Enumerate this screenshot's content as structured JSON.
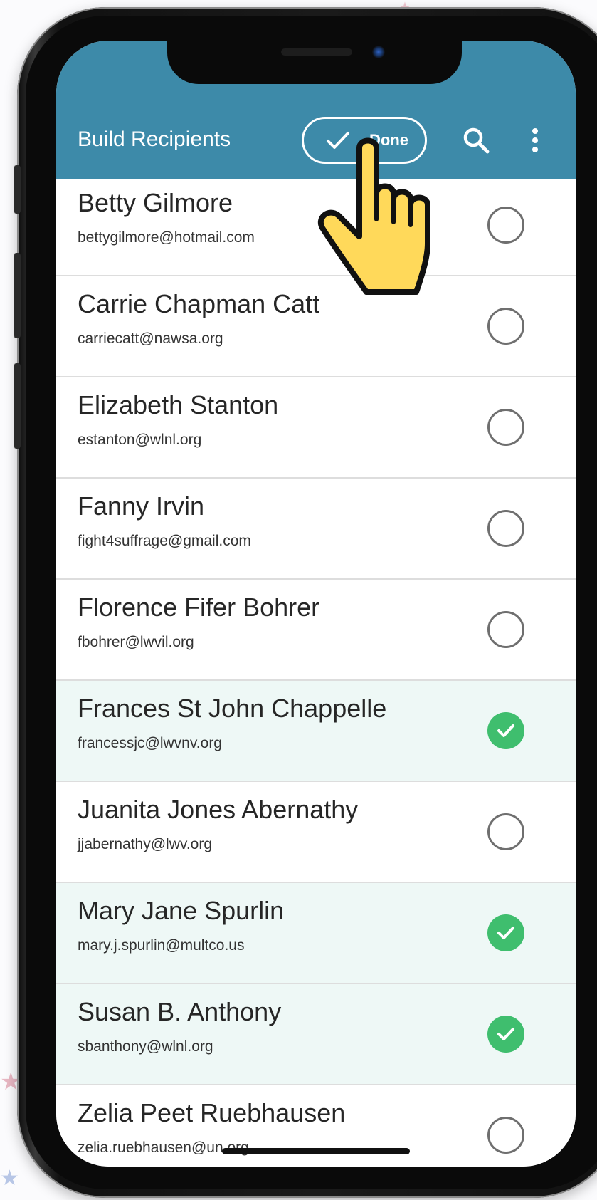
{
  "app_bar": {
    "title": "Build Recipients",
    "done_label": "Done",
    "background_color": "#3d8aa9",
    "icons": [
      "check-icon",
      "search-icon",
      "more-vert-icon"
    ]
  },
  "recipients": [
    {
      "name": "Betty Gilmore",
      "email": "bettygilmore@hotmail.com",
      "selected": false
    },
    {
      "name": "Carrie Chapman Catt",
      "email": "carriecatt@nawsa.org",
      "selected": false
    },
    {
      "name": "Elizabeth Stanton",
      "email": "estanton@wlnl.org",
      "selected": false
    },
    {
      "name": "Fanny Irvin",
      "email": "fight4suffrage@gmail.com",
      "selected": false
    },
    {
      "name": "Florence Fifer Bohrer",
      "email": "fbohrer@lwvil.org",
      "selected": false
    },
    {
      "name": "Frances St John Chappelle",
      "email": "francessjc@lwvnv.org",
      "selected": true
    },
    {
      "name": "Juanita Jones Abernathy",
      "email": "jjabernathy@lwv.org",
      "selected": false
    },
    {
      "name": "Mary Jane Spurlin",
      "email": "mary.j.spurlin@multco.us",
      "selected": true
    },
    {
      "name": "Susan B. Anthony",
      "email": "sbanthony@wlnl.org",
      "selected": true
    },
    {
      "name": "Zelia Peet Ruebhausen",
      "email": "zelia.ruebhausen@un.org",
      "selected": false
    }
  ],
  "colors": {
    "selected_check": "#3fbe6e",
    "selected_row_bg": "#eef8f6",
    "unselected_circle": "#6f6f6f",
    "pointer_hand": "#ffd95a"
  },
  "overlay": {
    "icon": "pointing-hand-icon"
  }
}
